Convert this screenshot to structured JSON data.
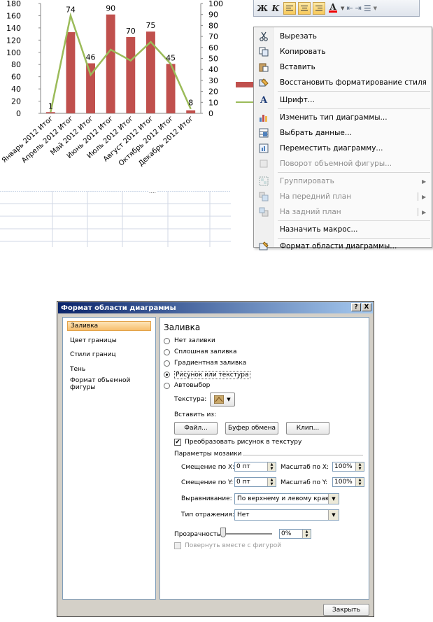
{
  "chart_data": {
    "type": "bar",
    "categories": [
      "Январь 2012 Итог",
      "Апрель 2012 Итог",
      "Май 2012 Итог",
      "Июнь 2012 Итог",
      "Июль 2012 Итог",
      "Август 2012 Итог",
      "Октябрь 2012 Итог",
      "Декабрь 2012 Итог"
    ],
    "series": [
      {
        "type": "bar",
        "color": "#c0504d",
        "values": [
          2,
          133,
          82,
          162,
          125,
          134,
          81,
          5
        ]
      },
      {
        "type": "line",
        "color": "#9bbb59",
        "axis": "right",
        "values": [
          1,
          89,
          35,
          58,
          48,
          65,
          45,
          4
        ]
      }
    ],
    "data_labels": [
      1,
      74,
      46,
      90,
      70,
      75,
      45,
      8
    ],
    "left_axis": {
      "min": 0,
      "max": 180,
      "step": 20,
      "ticks": [
        "0",
        "20",
        "40",
        "60",
        "80",
        "100",
        "120",
        "140",
        "160",
        "180"
      ]
    },
    "right_axis": {
      "min": 0,
      "max": 100,
      "step": 10,
      "ticks": [
        "0",
        "10",
        "20",
        "30",
        "40",
        "50",
        "60",
        "70",
        "80",
        "90",
        "100"
      ]
    },
    "grid": false
  },
  "toolbar": {
    "bold": "Ж",
    "italic": "К",
    "font_color": "А"
  },
  "context_menu": {
    "items": [
      {
        "label": "Вырезать",
        "icon": "scissors-icon",
        "disabled": false
      },
      {
        "label": "Копировать",
        "icon": "copy-icon",
        "disabled": false
      },
      {
        "label": "Вставить",
        "icon": "paste-icon",
        "disabled": false
      },
      {
        "label": "Восстановить форматирование стиля",
        "icon": "reset-style-icon",
        "disabled": false
      },
      {
        "label": "Шрифт...",
        "icon": "font-icon",
        "disabled": false
      },
      {
        "label": "Изменить тип диаграммы...",
        "icon": "chart-type-icon",
        "disabled": false
      },
      {
        "label": "Выбрать данные...",
        "icon": "select-data-icon",
        "disabled": false
      },
      {
        "label": "Переместить диаграмму...",
        "icon": "move-chart-icon",
        "disabled": false
      },
      {
        "label": "Поворот объемной фигуры...",
        "icon": "rotate-3d-icon",
        "disabled": true
      },
      {
        "label": "Группировать",
        "icon": "group-icon",
        "disabled": true
      },
      {
        "label": "На передний план",
        "icon": "bring-front-icon",
        "disabled": true
      },
      {
        "label": "На задний план",
        "icon": "send-back-icon",
        "disabled": true
      },
      {
        "label": "Назначить макрос...",
        "icon": "",
        "disabled": false
      },
      {
        "label": "Формат области диаграммы...",
        "icon": "format-area-icon",
        "disabled": false
      }
    ]
  },
  "dialog": {
    "title": "Формат области диаграммы",
    "help": "?",
    "close_x": "X",
    "left_items": [
      "Заливка",
      "Цвет границы",
      "Стили границ",
      "Тень",
      "Формат объемной фигуры"
    ],
    "section_title": "Заливка",
    "radios": [
      "Нет заливки",
      "Сплошная заливка",
      "Градиентная заливка",
      "Рисунок или текстура",
      "Автовыбор"
    ],
    "texture_label": "Текстура:",
    "insert_from": "Вставить из:",
    "btn_file": "Файл...",
    "btn_clipboard": "Буфер обмена",
    "btn_clip": "Клип...",
    "convert_checkbox": "Преобразовать рисунок в текстуру",
    "mosaic_title": "Параметры мозаики",
    "offset_x_label": "Смещение по X:",
    "offset_x": "0 пт",
    "scale_x_label": "Масштаб по X:",
    "scale_x": "100%",
    "offset_y_label": "Смещение по Y:",
    "offset_y": "0 пт",
    "scale_y_label": "Масштаб по Y:",
    "scale_y": "100%",
    "align_label": "Выравнивание:",
    "align_value": "По верхнему и левому краю",
    "mirror_label": "Тип отражения:",
    "mirror_value": "Нет",
    "transparency_label": "Прозрачность:",
    "transparency_value": "0%",
    "rotate_checkbox": "Повернуть вместе с фигурой",
    "close_button": "Закрыть"
  }
}
